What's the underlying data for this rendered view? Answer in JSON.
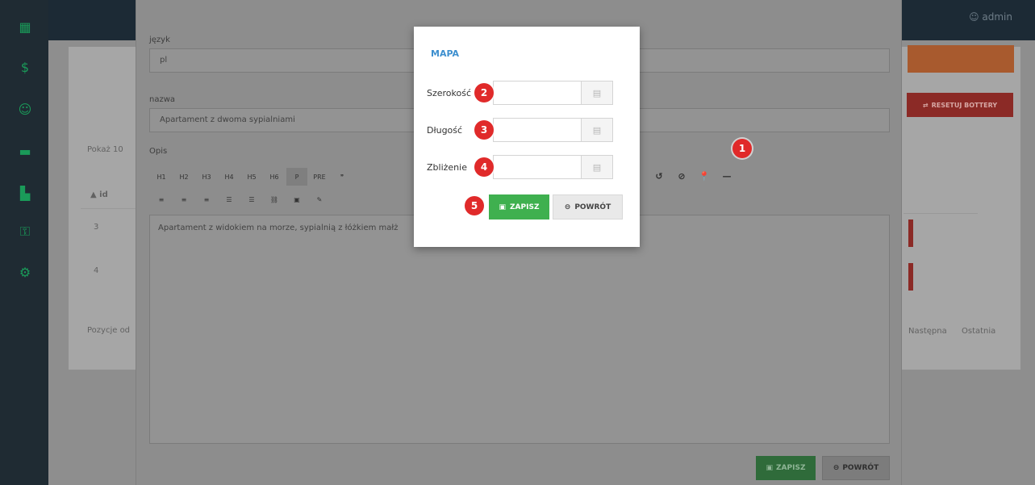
{
  "app": {
    "user_label": "admin",
    "sidebar_icons": [
      "calendar-icon",
      "dollar-icon",
      "users-icon",
      "bed-icon",
      "building-icon",
      "key-icon",
      "cogs-icon"
    ]
  },
  "background": {
    "show_label": "Pokaż",
    "show_count": "10",
    "column_id": "▲ id",
    "rows": [
      "3",
      "4"
    ],
    "footer_text": "Pozycje od",
    "reset_button": "RESETUJ BOTTERY",
    "pagination": {
      "next": "Następna",
      "last": "Ostatnia"
    }
  },
  "edit_form": {
    "lang_label": "język",
    "lang_value": "pl",
    "name_label": "nazwa",
    "name_value": "Apartament z dwoma sypialniami",
    "desc_label": "Opis",
    "toolbar_row1": [
      "H1",
      "H2",
      "H3",
      "H4",
      "H5",
      "H6",
      "P",
      "PRE",
      "❞"
    ],
    "toolbar_row2": [
      "≡",
      "≡",
      "≡",
      "☰",
      "☰",
      "⛓",
      "▣",
      "✎"
    ],
    "toolbar_right": [
      "C",
      "↺",
      "⊘",
      "📍",
      "—"
    ],
    "editor_text": "Apartament z widokiem na morze, sypialnią z łóżkiem małż",
    "save_label": "ZAPISZ",
    "back_label": "POWRÓT"
  },
  "map_dialog": {
    "title": "MAPA",
    "fields": [
      {
        "label": "Szerokość",
        "value": ""
      },
      {
        "label": "Długość",
        "value": ""
      },
      {
        "label": "Zbliżenie",
        "value": ""
      }
    ],
    "save_label": "ZAPISZ",
    "back_label": "POWRÓT"
  },
  "markers": [
    "1",
    "2",
    "3",
    "4",
    "5"
  ]
}
